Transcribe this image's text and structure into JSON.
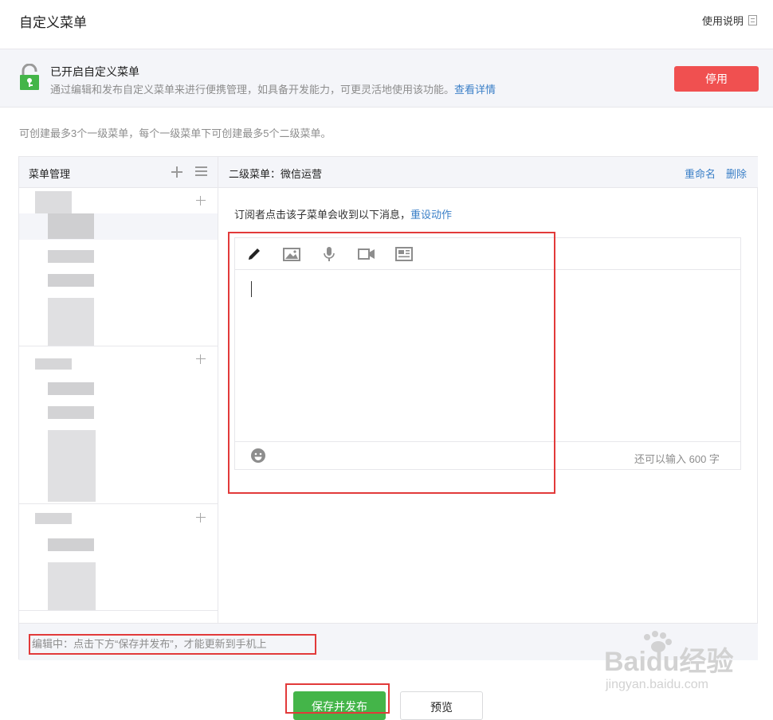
{
  "header": {
    "title": "自定义菜单",
    "help_label": "使用说明"
  },
  "notice": {
    "title": "已开启自定义菜单",
    "description": "通过编辑和发布自定义菜单来进行便携管理，如具备开发能力，可更灵活地使用该功能。",
    "link_label": "查看详情",
    "disable_label": "停用"
  },
  "hint": "可创建最多3个一级菜单，每个一级菜单下可创建最多5个二级菜单。",
  "sidebar": {
    "title": "菜单管理"
  },
  "main": {
    "header_label": "二级菜单：微信运营",
    "rename_label": "重命名",
    "delete_label": "删除",
    "message_prefix": "订阅者点击该子菜单会收到以下消息，",
    "reset_label": "重设动作",
    "counter": "还可以输入 600 字"
  },
  "status": {
    "text": "编辑中：点击下方“保存并发布”，才能更新到手机上"
  },
  "actions": {
    "save_label": "保存并发布",
    "preview_label": "预览"
  },
  "watermark": {
    "brand": "Baidu经验",
    "url": "jingyan.baidu.com"
  },
  "icons": [
    "lock-icon",
    "doc-icon",
    "plus-icon",
    "menu-lines-icon",
    "pencil-icon",
    "image-icon",
    "mic-icon",
    "video-icon",
    "news-icon",
    "emoji-icon"
  ],
  "colors": {
    "accent_blue": "#3a7fc7",
    "danger_red": "#f05050",
    "primary_green": "#44b549",
    "lock_green": "#44b549"
  }
}
